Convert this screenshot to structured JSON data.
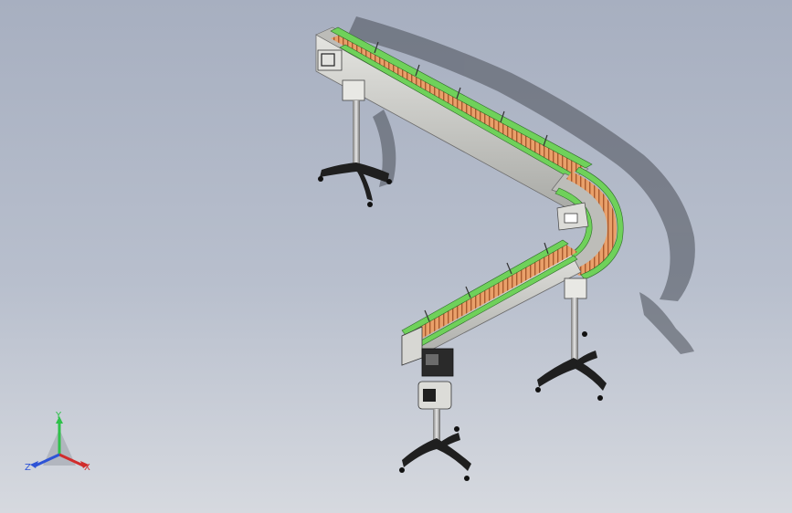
{
  "viewport": {
    "colors": {
      "bg_top": "#a7afc0",
      "bg_bottom": "#d6d9df",
      "belt": "#e9a06a",
      "guide_rail": "#6fd15a",
      "frame": "#c9c9c6",
      "stand": "#2b2b2b"
    }
  },
  "triad": {
    "y_label": "Y",
    "x_label": "X",
    "z_label": "Z",
    "colors": {
      "x": "#d12c2c",
      "y": "#2ec14a",
      "z": "#2d53d6"
    }
  }
}
